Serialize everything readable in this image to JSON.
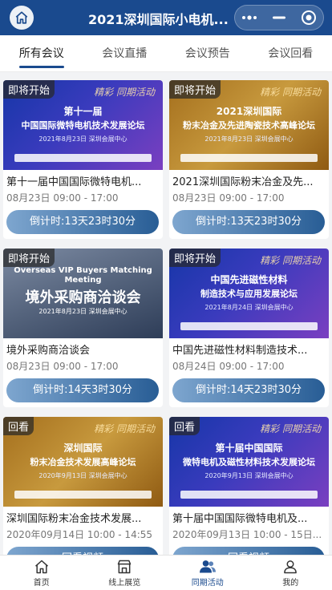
{
  "header": {
    "title": "2021深圳国际小电机...",
    "home_icon": "home-icon",
    "more_icon": "more-dots-icon",
    "minimize_icon": "minimize-icon",
    "close_icon": "target-close-icon",
    "background": "#1a4a8e"
  },
  "tabs": [
    {
      "label": "所有会议",
      "active": true
    },
    {
      "label": "会议直播",
      "active": false
    },
    {
      "label": "会议预告",
      "active": false
    },
    {
      "label": "会议回看",
      "active": false
    }
  ],
  "cards": [
    {
      "badge": "即将开始",
      "title": "第十一届中国国际微特电机...",
      "date": "08月23日 09:00 - 17:00",
      "button": "倒计时:13天23时30分",
      "banner": {
        "style": "blue",
        "line1": "第十一届",
        "line2": "中国国际微特电机技术发展论坛",
        "line3": "2021年8月23日  深圳会展中心",
        "deco": "精彩 同期活动"
      }
    },
    {
      "badge": "即将开始",
      "title": "2021深圳国际粉末冶金及先...",
      "date": "08月23日 09:00 - 17:00",
      "button": "倒计时:13天23时30分",
      "banner": {
        "style": "gold",
        "line1": "2021深圳国际",
        "line2": "粉末冶金及先进陶瓷技术高峰论坛",
        "line3": "2021年8月23日  深圳会展中心",
        "deco": "精彩 同期活动"
      }
    },
    {
      "badge": "即将开始",
      "title": "境外采购商洽谈会",
      "date": "08月23日 09:00 - 17:00",
      "button": "倒计时:14天3时30分",
      "banner": {
        "style": "photo",
        "line1": "Overseas VIP Buyers Matching Meeting",
        "line2": "境外采购商洽谈会",
        "line3": "2021年8月23日   深圳会展中心",
        "deco": ""
      }
    },
    {
      "badge": "即将开始",
      "title": "中国先进磁性材料制造技术...",
      "date": "08月24日 09:00 - 17:00",
      "button": "倒计时:14天23时30分",
      "banner": {
        "style": "blue",
        "line1": "中国先进磁性材料",
        "line2": "制造技术与应用发展论坛",
        "line3": "2021年8月24日  深圳会展中心",
        "deco": "精彩 同期活动"
      }
    },
    {
      "badge": "回看",
      "title": "深圳国际粉末冶金技术发展...",
      "date": "2020年09月14日 10:00 - 14:55",
      "button": "回看视频",
      "banner": {
        "style": "gold",
        "line1": "深圳国际",
        "line2": "粉末冶金技术发展高峰论坛",
        "line3": "2020年9月13日  深圳会展中心",
        "deco": "精彩 同期活动"
      }
    },
    {
      "badge": "回看",
      "title": "第十届中国国际微特电机及...",
      "date": "2020年09月13日 10:00 - 15日...",
      "button": "回看视频",
      "banner": {
        "style": "blue",
        "line1": "第十届中国国际",
        "line2": "微特电机及磁性材料技术发展论坛",
        "line3": "2020年9月13日  深圳会展中心",
        "deco": "精彩 同期活动"
      }
    }
  ],
  "bottom_nav": [
    {
      "label": "首页",
      "icon": "home-icon",
      "active": false
    },
    {
      "label": "线上展览",
      "icon": "store-icon",
      "active": false
    },
    {
      "label": "同期活动",
      "icon": "people-icon",
      "active": true
    },
    {
      "label": "我的",
      "icon": "person-icon",
      "active": false
    }
  ]
}
